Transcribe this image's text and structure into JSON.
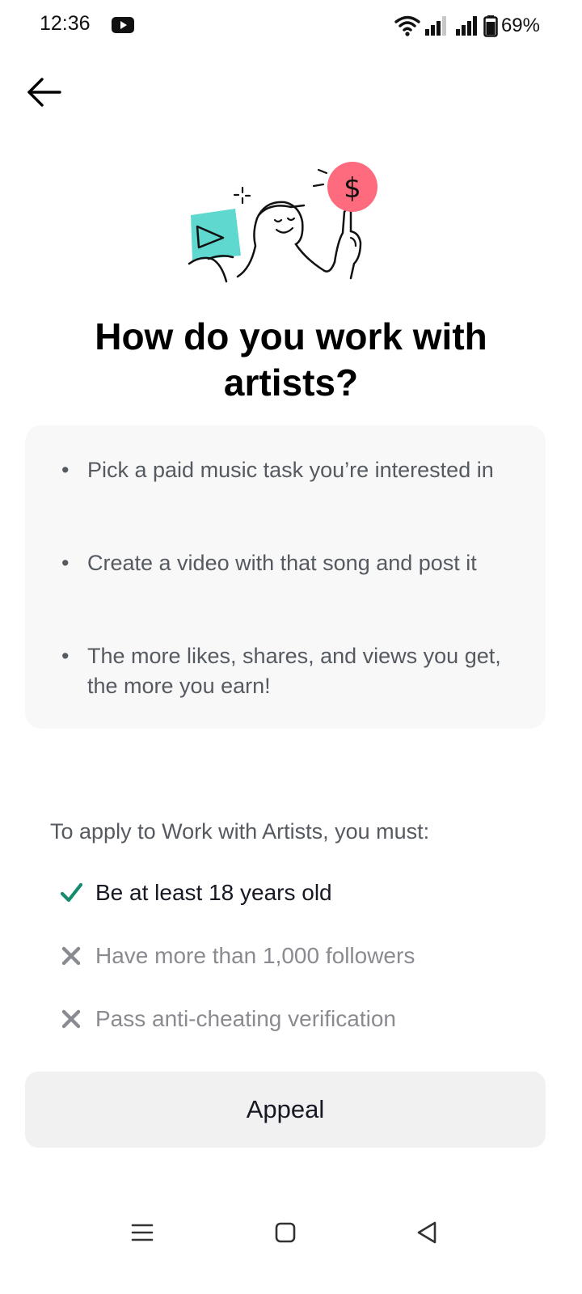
{
  "status_bar": {
    "time": "12:36",
    "notification_icon": "youtube-icon",
    "battery_percent": "69%",
    "icons": [
      "wifi-icon",
      "signal-icon",
      "signal-icon",
      "battery-icon"
    ]
  },
  "header": {
    "back_icon": "back-arrow-icon"
  },
  "illustration": {
    "dollar_symbol": "$",
    "colors": {
      "teal": "#5fd8cf",
      "pink": "#fe6a7e"
    }
  },
  "title": "How do you work with artists?",
  "info_card": {
    "bullets": [
      "Pick a paid music task you’re interested in",
      "Create a video with that song and post it",
      "The more likes, shares, and views you get, the more you earn!"
    ]
  },
  "requirements": {
    "heading": "To apply to Work with Artists, you must:",
    "items": [
      {
        "label": "Be at least 18 years old",
        "status": "met",
        "icon": "checkmark-icon"
      },
      {
        "label": "Have more than 1,000 followers",
        "status": "unmet",
        "icon": "cross-icon"
      },
      {
        "label": "Pass anti-cheating verification",
        "status": "unmet",
        "icon": "cross-icon"
      }
    ]
  },
  "appeal_button": {
    "label": "Appeal"
  },
  "colors": {
    "check_green": "#168c6f",
    "cross_gray": "#8a8b91",
    "card_bg": "#f8f8f8",
    "button_bg": "#f1f1f2"
  },
  "nav_bar": {
    "buttons": [
      "menu-icon",
      "home-icon",
      "back-icon"
    ]
  }
}
